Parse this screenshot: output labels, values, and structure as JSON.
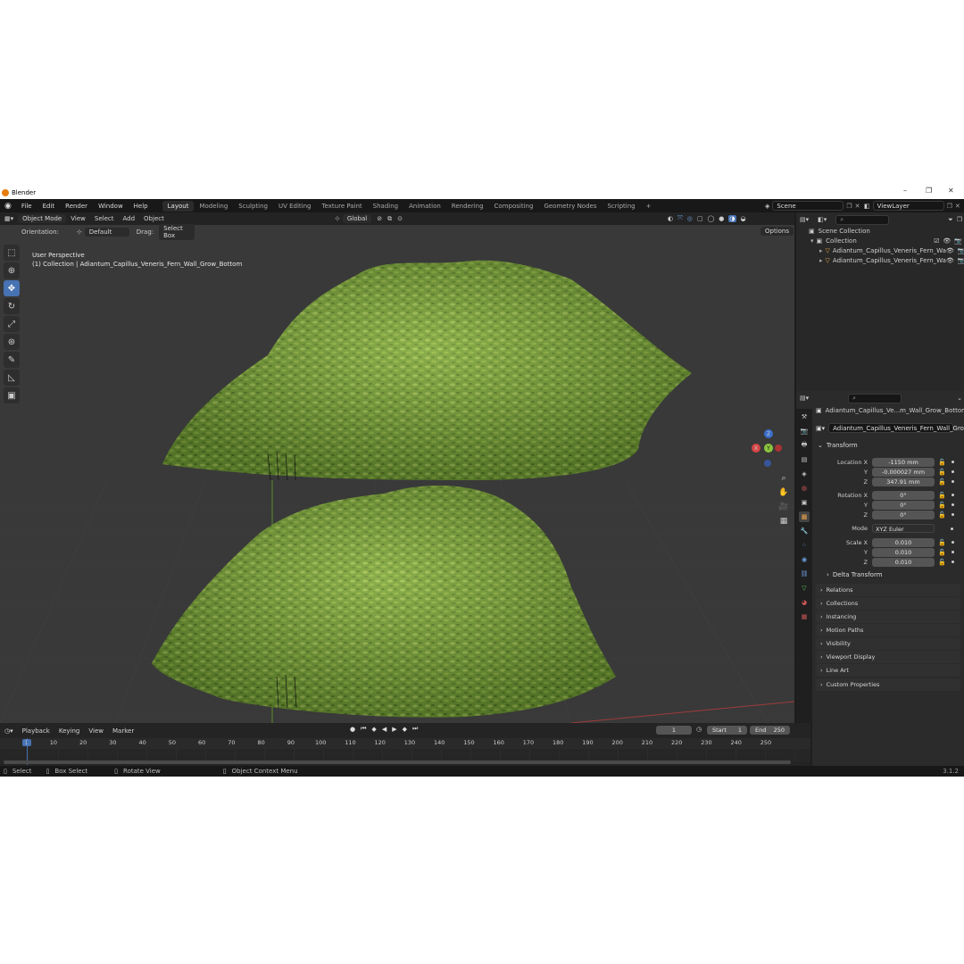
{
  "window": {
    "title": "Blender"
  },
  "menu": {
    "items": [
      "File",
      "Edit",
      "Render",
      "Window",
      "Help"
    ]
  },
  "workspaces": [
    "Layout",
    "Modeling",
    "Sculpting",
    "UV Editing",
    "Texture Paint",
    "Shading",
    "Animation",
    "Rendering",
    "Compositing",
    "Geometry Nodes",
    "Scripting"
  ],
  "active_workspace": "Layout",
  "scene": {
    "name": "Scene",
    "view_layer": "ViewLayer"
  },
  "viewport": {
    "mode": "Object Mode",
    "menus": [
      "View",
      "Select",
      "Add",
      "Object"
    ],
    "orientation_label": "Orientation:",
    "orientation_value": "Default",
    "drag_label": "Drag:",
    "drag_value": "Select Box",
    "transform_orientation": "Global",
    "options_label": "Options",
    "overlay_title": "User Perspective",
    "overlay_subtitle": "(1) Collection | Adiantum_Capillus_Veneris_Fern_Wall_Grow_Bottom",
    "gizmo": {
      "x": "X",
      "y": "Y",
      "z": "Z"
    }
  },
  "outliner": {
    "root": "Scene Collection",
    "collection": "Collection",
    "objects": [
      "Adiantum_Capillus_Veneris_Fern_Wa",
      "Adiantum_Capillus_Veneris_Fern_Wa"
    ]
  },
  "properties": {
    "object_name": "Adiantum_Capillus_Ve...m_Wall_Grow_Bottom",
    "data_name": "Adiantum_Capillus_Veneris_Fern_Wall_Grow_B...",
    "transform_label": "Transform",
    "location_label": "Location X",
    "location": [
      "-1150 mm",
      "-0.000027 mm",
      "347.91 mm"
    ],
    "rotation_label": "Rotation X",
    "rotation": [
      "0°",
      "0°",
      "0°"
    ],
    "mode_label": "Mode",
    "mode_value": "XYZ Euler",
    "scale_label": "Scale X",
    "scale": [
      "0.010",
      "0.010",
      "0.010"
    ],
    "axis_y": "Y",
    "axis_z": "Z",
    "delta_transform": "Delta Transform",
    "panels": [
      "Relations",
      "Collections",
      "Instancing",
      "Motion Paths",
      "Visibility",
      "Viewport Display",
      "Line Art",
      "Custom Properties"
    ]
  },
  "timeline": {
    "menus": [
      "Playback",
      "Keying",
      "View",
      "Marker"
    ],
    "current_frame": "1",
    "start_label": "Start",
    "start": "1",
    "end_label": "End",
    "end": "250",
    "ruler": [
      "1",
      "10",
      "20",
      "30",
      "40",
      "50",
      "60",
      "70",
      "80",
      "90",
      "100",
      "110",
      "120",
      "130",
      "140",
      "150",
      "160",
      "170",
      "180",
      "190",
      "200",
      "210",
      "220",
      "230",
      "240",
      "250"
    ]
  },
  "status": {
    "items": [
      "Select",
      "Box Select",
      "Rotate View",
      "Object Context Menu"
    ],
    "version": "3.1.2"
  },
  "colors": {
    "accent": "#4772b3",
    "fern": "#7aa43a",
    "viewport_bg": "#393939"
  }
}
